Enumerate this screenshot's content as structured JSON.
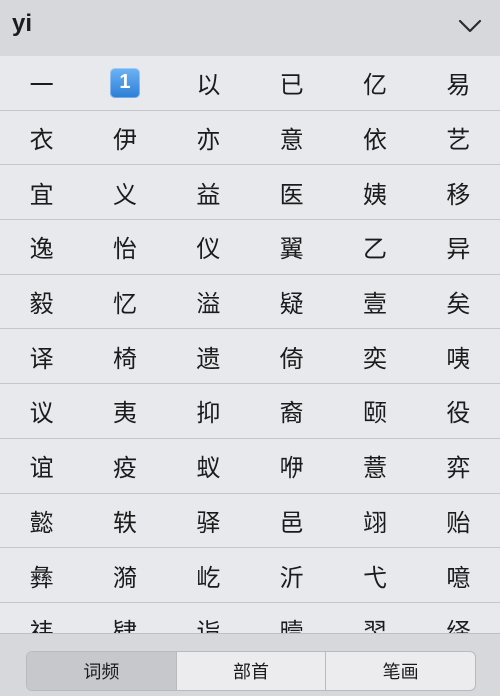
{
  "header": {
    "pinyin": "yi",
    "collapse_icon": "chevron-down-icon"
  },
  "candidates": [
    "一",
    "1️⃣",
    "以",
    "已",
    "亿",
    "易",
    "衣",
    "伊",
    "亦",
    "意",
    "依",
    "艺",
    "宜",
    "义",
    "益",
    "医",
    "姨",
    "移",
    "逸",
    "怡",
    "仪",
    "翼",
    "乙",
    "异",
    "毅",
    "忆",
    "溢",
    "疑",
    "壹",
    "矣",
    "译",
    "椅",
    "遗",
    "倚",
    "奕",
    "咦",
    "议",
    "夷",
    "抑",
    "裔",
    "颐",
    "役",
    "谊",
    "疫",
    "蚁",
    "咿",
    "薏",
    "弈",
    "懿",
    "轶",
    "驿",
    "邑",
    "翊",
    "贻",
    "彝",
    "漪",
    "屹",
    "沂",
    "弋",
    "噫",
    "祎",
    "肄",
    "诣",
    "曀",
    "翌",
    "绎"
  ],
  "sort_tabs": [
    "词频",
    "部首",
    "笔画"
  ],
  "active_sort_tab": "词频"
}
